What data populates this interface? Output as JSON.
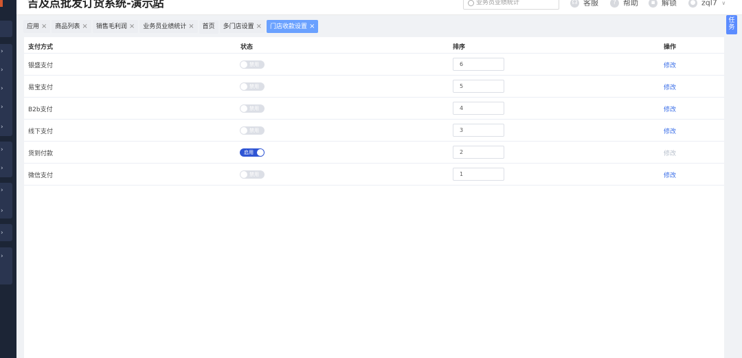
{
  "header": {
    "title": "吉及点批发订货系统-演示站",
    "search_placeholder": "业务员业绩统计",
    "service_label": "客服",
    "help_label": "帮助",
    "unlock_label": "解锁",
    "user_label": "zql7"
  },
  "task_button": "任务",
  "tabs": [
    {
      "label": "应用"
    },
    {
      "label": "商品列表"
    },
    {
      "label": "销售毛利润"
    },
    {
      "label": "业务员业绩统计"
    },
    {
      "label": "首页"
    },
    {
      "label": "多门店设置"
    },
    {
      "label": "门店收款设置"
    }
  ],
  "table": {
    "headers": {
      "method": "支付方式",
      "status": "状态",
      "sort": "排序",
      "action": "操作"
    },
    "rows": [
      {
        "method": "银盛支付",
        "status": "禁用",
        "sort": "6",
        "action": "修改"
      },
      {
        "method": "易宝支付",
        "status": "禁用",
        "sort": "5",
        "action": "修改"
      },
      {
        "method": "B2b支付",
        "status": "禁用",
        "sort": "4",
        "action": "修改"
      },
      {
        "method": "线下支付",
        "status": "禁用",
        "sort": "3",
        "action": "修改"
      },
      {
        "method": "货到付款",
        "status": "启用",
        "sort": "2",
        "action": "修改"
      },
      {
        "method": "微信支付",
        "status": "禁用",
        "sort": "1",
        "action": "修改"
      }
    ]
  },
  "colors": {
    "accent": "#2f55d4",
    "link": "#3a6ee8",
    "active_tab": "#6aa1ff",
    "sidebar": "#1c2536"
  }
}
